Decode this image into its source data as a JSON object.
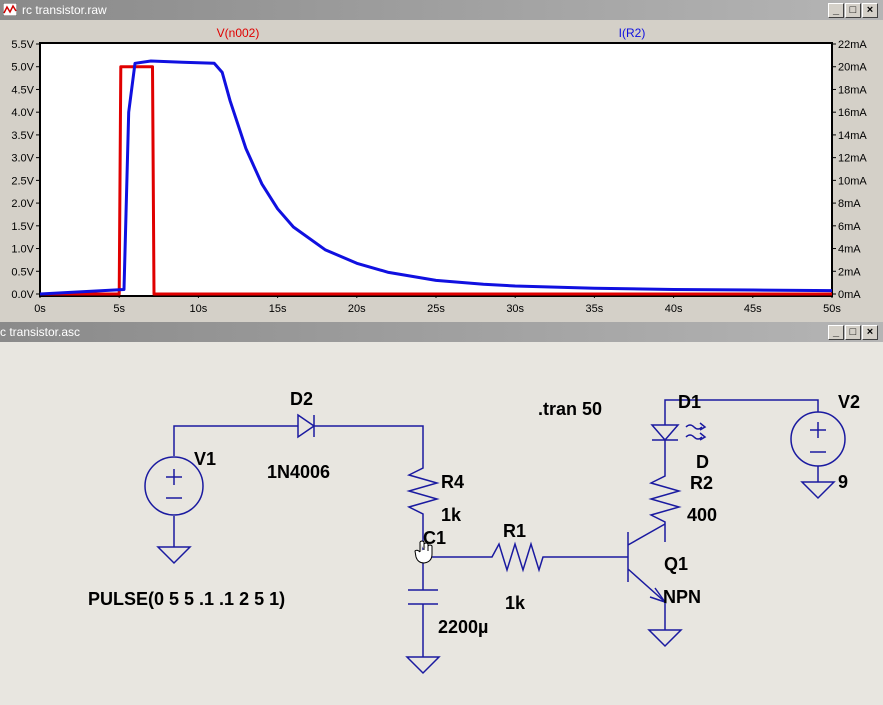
{
  "waveform_window": {
    "title": "rc transistor.raw",
    "controls": {
      "minimize": "_",
      "maximize": "□",
      "close": "×"
    },
    "trace_left_label": "V(n002)",
    "trace_right_label": "I(R2)",
    "colors": {
      "v_trace": "#e00000",
      "i_trace": "#1010e0",
      "background": "#ffffff"
    }
  },
  "schematic_window": {
    "title": "c transistor.asc",
    "controls": {
      "minimize": "_",
      "maximize": "□",
      "close": "×"
    },
    "directive": ".tran 50",
    "components": {
      "v1": {
        "name": "V1",
        "value": "PULSE(0 5 5 .1 .1 2 5 1)"
      },
      "d2": {
        "name": "D2",
        "value": "1N4006"
      },
      "r4": {
        "name": "R4",
        "value": "1k"
      },
      "c1": {
        "name": "C1",
        "value": "2200µ"
      },
      "r1": {
        "name": "R1",
        "value": "1k"
      },
      "q1": {
        "name": "Q1",
        "value": "NPN"
      },
      "d1": {
        "name": "D1",
        "value": "D"
      },
      "r2": {
        "name": "R2",
        "value": "400"
      },
      "v2": {
        "name": "V2",
        "value": "9"
      }
    },
    "colors": {
      "wire": "#1a1aa0",
      "background": "#e8e6e0",
      "node_dot": "#0000ff"
    }
  },
  "chart_data": {
    "type": "line",
    "xlabel": "",
    "x_ticks": [
      "0s",
      "5s",
      "10s",
      "15s",
      "20s",
      "25s",
      "30s",
      "35s",
      "40s",
      "45s",
      "50s"
    ],
    "xlim": [
      0,
      50
    ],
    "y_left_ticks": [
      "0.0V",
      "0.5V",
      "1.0V",
      "1.5V",
      "2.0V",
      "2.5V",
      "3.0V",
      "3.5V",
      "4.0V",
      "4.5V",
      "5.0V",
      "5.5V"
    ],
    "y_left_lim": [
      0,
      5.5
    ],
    "y_right_ticks": [
      "0mA",
      "2mA",
      "4mA",
      "6mA",
      "8mA",
      "10mA",
      "12mA",
      "14mA",
      "16mA",
      "18mA",
      "20mA",
      "22mA"
    ],
    "y_right_lim": [
      0,
      22
    ],
    "series": [
      {
        "name": "V(n002)",
        "axis": "left",
        "color": "#e00000",
        "x": [
          0,
          5.0,
          5.1,
          7.1,
          7.2,
          50
        ],
        "y": [
          0,
          0,
          5.0,
          5.0,
          0,
          0
        ]
      },
      {
        "name": "I(R2)",
        "axis": "right",
        "color": "#1010e0",
        "x": [
          0,
          5.3,
          5.6,
          6.0,
          7.0,
          9.0,
          11.0,
          11.5,
          12.0,
          13.0,
          14.0,
          15.0,
          16.0,
          18.0,
          20.0,
          22.0,
          25.0,
          28.0,
          30.0,
          35.0,
          40.0,
          45.0,
          50.0
        ],
        "y": [
          0,
          0.4,
          16.0,
          20.3,
          20.5,
          20.4,
          20.3,
          19.5,
          17.0,
          12.8,
          9.7,
          7.5,
          5.9,
          3.9,
          2.7,
          1.9,
          1.2,
          0.85,
          0.7,
          0.5,
          0.4,
          0.35,
          0.3
        ]
      }
    ]
  }
}
